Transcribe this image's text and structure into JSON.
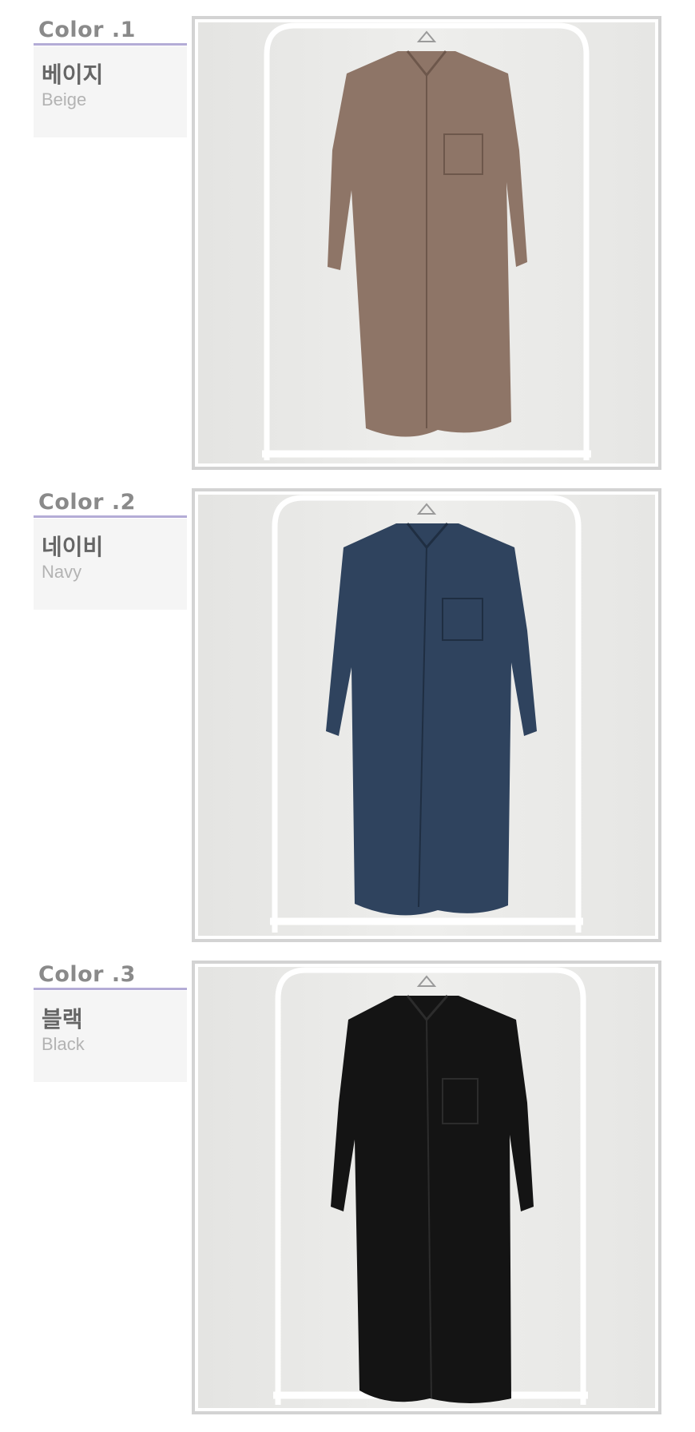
{
  "colors": [
    {
      "title": "Color .1",
      "name_ko": "베이지",
      "name_en": "Beige",
      "swatch": "#8e7567"
    },
    {
      "title": "Color .2",
      "name_ko": "네이비",
      "name_en": "Navy",
      "swatch": "#2f435e"
    },
    {
      "title": "Color .3",
      "name_ko": "블랙",
      "name_en": "Black",
      "swatch": "#141414"
    }
  ],
  "icons": {
    "garment": "shirt-dress-icon",
    "rack": "clothing-rack-icon"
  }
}
